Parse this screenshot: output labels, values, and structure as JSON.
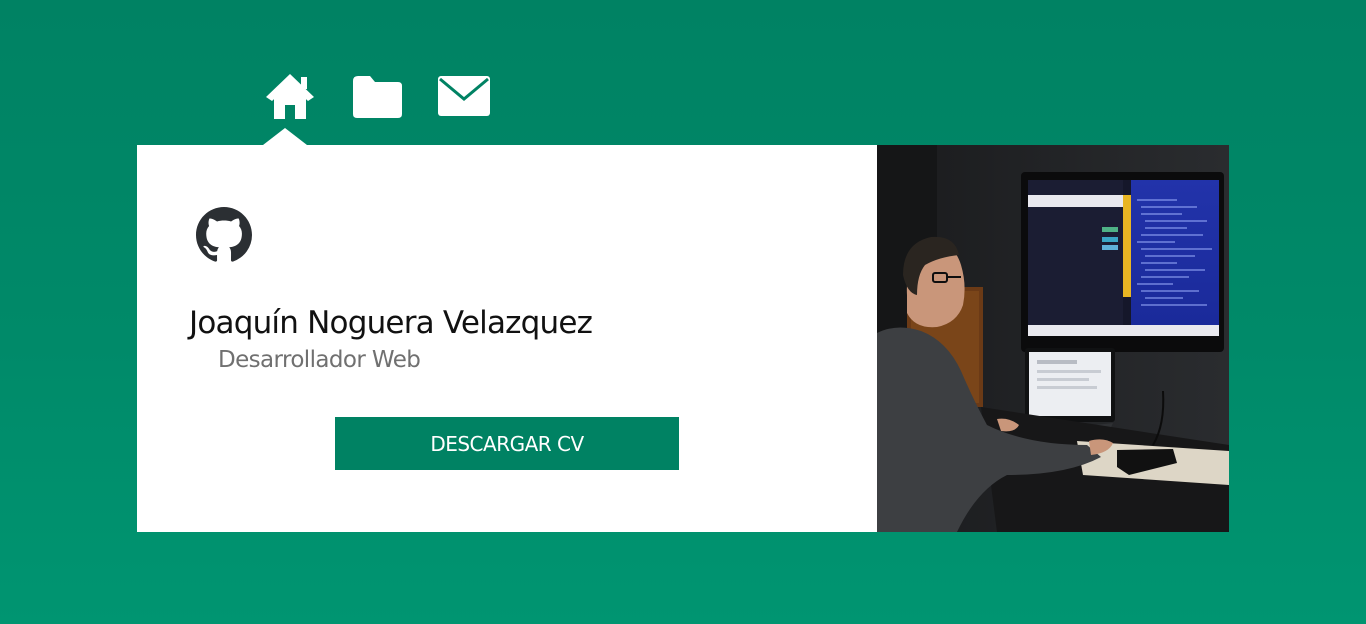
{
  "nav": {
    "items": [
      {
        "icon": "home-icon",
        "active": true
      },
      {
        "icon": "folder-icon",
        "active": false
      },
      {
        "icon": "envelope-icon",
        "active": false
      }
    ]
  },
  "profile": {
    "social_icon": "github-icon",
    "name": "Joaquín Noguera Velazquez",
    "role": "Desarrollador Web",
    "cv_button_label": "DESCARGAR CV"
  },
  "photo": {
    "description_icon": "developer-at-workstation-photo"
  },
  "colors": {
    "background": "#008a69",
    "accent": "#008263",
    "card": "#ffffff",
    "name_text": "#111111",
    "role_text": "#707070"
  }
}
